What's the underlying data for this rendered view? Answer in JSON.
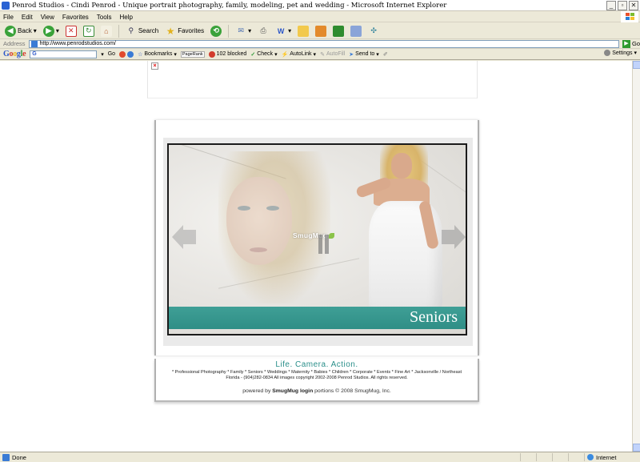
{
  "window": {
    "title": "Penrod Studios - Cindi Penrod - Unique portrait photography, family, modeling, pet and wedding  - Microsoft Internet Explorer"
  },
  "menu": [
    "File",
    "Edit",
    "View",
    "Favorites",
    "Tools",
    "Help"
  ],
  "toolbar": {
    "back_label": "Back",
    "search_label": "Search",
    "favorites_label": "Favorites"
  },
  "address": {
    "label": "Address",
    "url": "http://www.penrodstudios.com/",
    "go_label": "Go"
  },
  "google_bar": {
    "logo": "Google",
    "search_value": "G",
    "go_label": "Go",
    "bookmarks_label": "Bookmarks",
    "pagerank_label": "PageRank",
    "blocked_label": "102 blocked",
    "check_label": "Check",
    "autolink_label": "AutoLink",
    "autofill_label": "AutoFill",
    "sendto_label": "Send to",
    "settings_label": "Settings"
  },
  "gallery": {
    "watermark": "SmugMug",
    "caption": "Seniors"
  },
  "footer": {
    "tagline": "Life. Camera. Action.",
    "services": "* Professional Photography * Family * Seniors * Weddings * Maternity * Babies * Children * Corporate * Events * Fine Art * Jacksonville / Northeast Florida - (904)282-0834 All images copyright 2002-2008 Penrod Studios. All rights reserved.",
    "powered_prefix": "powered by",
    "powered_link": "SmugMug",
    "login_link": "login",
    "powered_suffix": "portions © 2008 SmugMug, Inc."
  },
  "status": {
    "text": "Done",
    "zone": "Internet"
  },
  "colors": {
    "caption_strip": "#2f8e86",
    "tagline": "#2a8f8a"
  }
}
